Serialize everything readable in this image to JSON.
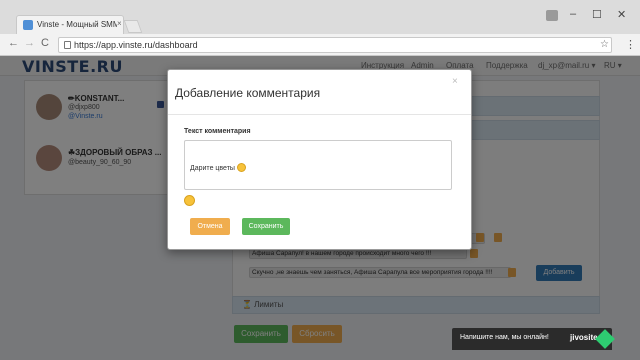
{
  "browser": {
    "tab_title": "Vinste - Мощный SMM",
    "tab_close": "×",
    "url": "https://app.vinste.ru/dashboard",
    "win_min": "–",
    "win_max": "☐",
    "win_close": "✕",
    "back_icon": "←",
    "forward_icon": "→",
    "reload_icon": "C",
    "star_icon": "☆",
    "menu_icon": "⋮"
  },
  "site": {
    "logo": "VINSTE.RU",
    "nav": [
      "Инструкция",
      "Admin",
      "Оплата",
      "Поддержка",
      "dj_xp@mail.ru ▾",
      "RU ▾"
    ]
  },
  "accounts": [
    {
      "name": "✏KONSTANT...",
      "handle": "@djxp800",
      "link": "@Vinste.ru"
    },
    {
      "name": "☘ЗДОРОВЫЙ ОБРАЗ ...",
      "handle": "@beauty_90_60_90"
    }
  ],
  "comments": [
    {
      "text": "Афиша Сарапул! в нашем городе происходит много чего !!!"
    },
    {
      "text": "Скучно ,не знаешь чем заняться, Афиша Сарапула все мероприятия города !!!!"
    }
  ],
  "add_button": "Добавить",
  "limits_label": "⏳ Лимиты",
  "main_buttons": {
    "save": "Сохранить",
    "reset": "Сбросить"
  },
  "modal": {
    "title": "Добавление комментария",
    "close": "×",
    "field_label": "Текст комментария",
    "comment_value": "Дарите цветы",
    "cancel": "Отмена",
    "save": "Сохранить"
  },
  "chat": {
    "text": "Напишите нам, мы онлайн!",
    "brand": "jivosite"
  }
}
